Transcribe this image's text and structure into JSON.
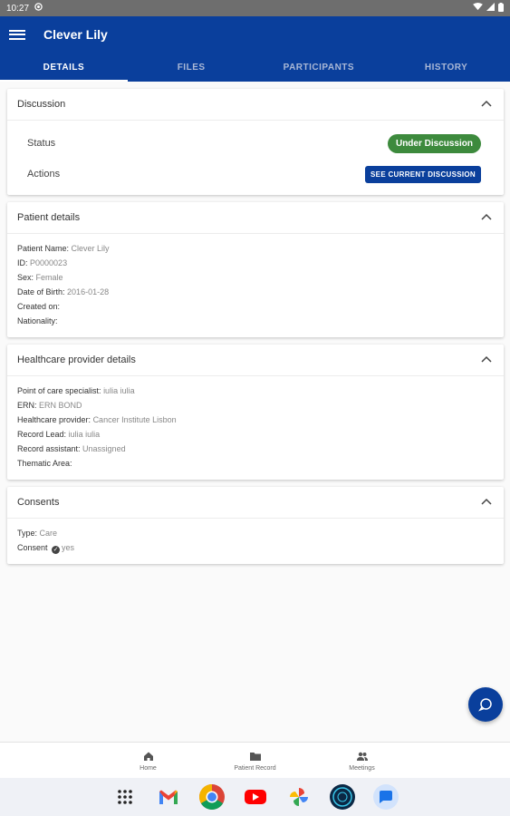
{
  "status_bar": {
    "time": "10:27"
  },
  "app_bar": {
    "title": "Clever Lily"
  },
  "tabs": [
    {
      "label": "DETAILS",
      "active": true
    },
    {
      "label": "FILES",
      "active": false
    },
    {
      "label": "PARTICIPANTS",
      "active": false
    },
    {
      "label": "HISTORY",
      "active": false
    }
  ],
  "discussion": {
    "title": "Discussion",
    "status_label": "Status",
    "status_value": "Under Discussion",
    "actions_label": "Actions",
    "action_button": "SEE CURRENT DISCUSSION"
  },
  "patient_details": {
    "title": "Patient details",
    "fields": [
      {
        "key": "Patient Name:",
        "value": "Clever Lily"
      },
      {
        "key": "ID:",
        "value": "P0000023"
      },
      {
        "key": "Sex:",
        "value": "Female"
      },
      {
        "key": "Date of Birth:",
        "value": "2016-01-28"
      },
      {
        "key": "Created on:",
        "value": ""
      },
      {
        "key": "Nationality:",
        "value": ""
      }
    ]
  },
  "healthcare_provider": {
    "title": "Healthcare provider details",
    "fields": [
      {
        "key": "Point of care specialist:",
        "value": "iulia iulia"
      },
      {
        "key": "ERN:",
        "value": "ERN BOND"
      },
      {
        "key": "Healthcare provider:",
        "value": "Cancer Institute Lisbon"
      },
      {
        "key": "Record Lead:",
        "value": "iulia iulia"
      },
      {
        "key": "Record assistant:",
        "value": "Unassigned"
      },
      {
        "key": "Thematic Area:",
        "value": ""
      }
    ]
  },
  "consents": {
    "title": "Consents",
    "type_key": "Type:",
    "type_value": "Care",
    "consent_key": "Consent",
    "consent_value": "yes"
  },
  "bottom_nav": [
    {
      "label": "Home",
      "icon": "home-icon"
    },
    {
      "label": "Patient Record",
      "icon": "folder-icon"
    },
    {
      "label": "Meetings",
      "icon": "people-icon"
    }
  ],
  "dock": [
    "apps-grid-icon",
    "gmail-icon",
    "chrome-icon",
    "youtube-icon",
    "photos-icon",
    "app-icon",
    "messages-icon"
  ],
  "colors": {
    "primary": "#0a3f9c",
    "status_green": "#3d8a3d"
  }
}
